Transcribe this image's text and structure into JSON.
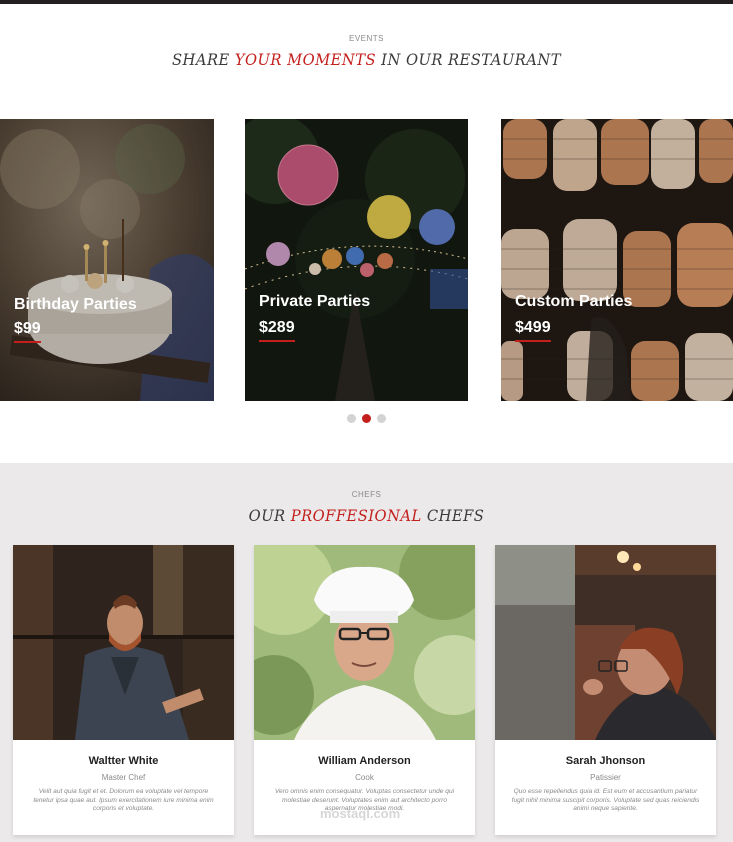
{
  "events": {
    "label": "EVENTS",
    "title_part1": "SHARE ",
    "title_accent": "YOUR MOMENTS",
    "title_part2": " IN OUR RESTAURANT",
    "cards": [
      {
        "name": "Birthday Parties",
        "price": "$99"
      },
      {
        "name": "Private Parties",
        "price": "$289"
      },
      {
        "name": "Custom Parties",
        "price": "$499"
      }
    ],
    "active_slide": 2,
    "slide_count": 3
  },
  "chefs": {
    "label": "CHEFS",
    "title_part1": "OUR ",
    "title_accent": "PROFFESIONAL",
    "title_part2": " CHEFS",
    "cards": [
      {
        "name": "Waltter White",
        "role": "Master Chef",
        "text": "Velit aut quia fugit et et. Dolorum ea voluptate vel tempore tenetur ipsa quae aut. Ipsum exercitationem iure minima enim corporis et voluptate."
      },
      {
        "name": "William Anderson",
        "role": "Cook",
        "text": "Vero omnis enim consequatur. Voluptas consectetur unde qui molestiae deserunt. Voluptates enim aut architecto porro aspernatur molestiae modi."
      },
      {
        "name": "Sarah Jhonson",
        "role": "Patissier",
        "text": "Quo esse repellendus quia id. Est eum et accusantium pariatur fugit nihil minima suscipit corporis. Voluptate sed quas reiciendis animi neque sapiente."
      }
    ]
  },
  "watermark": "mostaql.com",
  "colors": {
    "accent": "#c3201d",
    "section_bg": "#ece9ea",
    "topbar": "#231f20"
  }
}
